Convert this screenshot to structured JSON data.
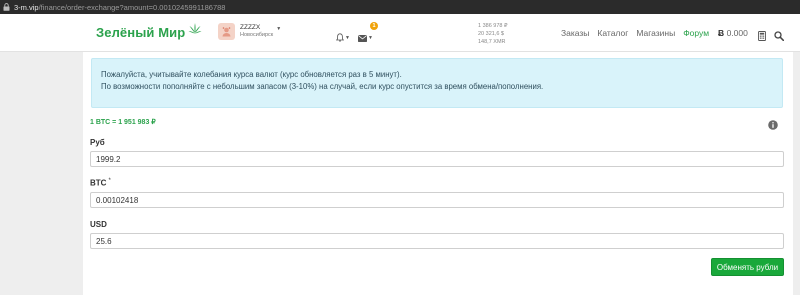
{
  "browser": {
    "host": "3-m.vip",
    "path": "/finance/order-exchange?amount=0.0010245991186788"
  },
  "header": {
    "logo": "Зелёный Мир",
    "user": {
      "name": "ZZZZX",
      "city": "Новосибирск"
    },
    "mail_badge": "1",
    "balances": [
      "1 386 978 ₽",
      "20 321,6 $",
      "148,7 XMR"
    ],
    "nav": [
      {
        "label": "Заказы"
      },
      {
        "label": "Каталог"
      },
      {
        "label": "Магазины"
      },
      {
        "label": "Форум"
      }
    ],
    "btc_symbol": "Ƀ",
    "btc_balance": "0.000"
  },
  "alert": {
    "line1": "Пожалуйста, учитывайте колебания курса валют (курс обновляется раз в 5 минут).",
    "line2": "По возможности пополняйте с небольшим запасом (3-10%) на случай, если курс опустится за время обмена/пополнения."
  },
  "rate": "1 BTC = 1 951 983 ₽",
  "form": {
    "rub": {
      "label": "Руб",
      "value": "1999.2"
    },
    "btc": {
      "label": "BTC",
      "required_mark": "*",
      "value": "0.00102418"
    },
    "usd": {
      "label": "USD",
      "value": "25.6"
    },
    "submit_label": "Обменять рубли"
  },
  "colors": {
    "brand_green": "#2ba24c",
    "button_green": "#19a83a",
    "alert_bg": "#d9f3fa",
    "badge": "#f0a30a"
  },
  "icons": [
    "lock-icon",
    "leaf-icon",
    "avatar",
    "bell-icon",
    "mail-icon",
    "calculator-icon",
    "search-icon",
    "info-icon"
  ]
}
